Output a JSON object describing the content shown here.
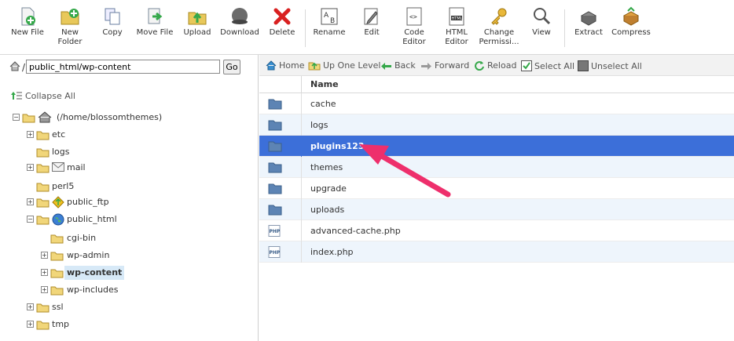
{
  "toolbar": {
    "buttons": [
      {
        "label": "New File",
        "icon": "new-file-icon"
      },
      {
        "label": "New Folder",
        "icon": "new-folder-icon"
      },
      {
        "label": "Copy",
        "icon": "copy-icon"
      },
      {
        "label": "Move File",
        "icon": "move-file-icon"
      },
      {
        "label": "Upload",
        "icon": "upload-icon"
      },
      {
        "label": "Download",
        "icon": "download-icon"
      },
      {
        "label": "Delete",
        "icon": "delete-icon"
      },
      {
        "label": "Rename",
        "icon": "rename-icon"
      },
      {
        "label": "Edit",
        "icon": "edit-icon"
      },
      {
        "label": "Code Editor",
        "icon": "code-editor-icon"
      },
      {
        "label": "HTML Editor",
        "icon": "html-editor-icon"
      },
      {
        "label": "Change Permissi...",
        "icon": "key-icon"
      },
      {
        "label": "View",
        "icon": "magnifier-icon"
      },
      {
        "label": "Extract",
        "icon": "extract-icon"
      },
      {
        "label": "Compress",
        "icon": "compress-icon"
      }
    ]
  },
  "left": {
    "path_value": "public_html/wp-content",
    "go_label": "Go",
    "collapse_label": "Collapse All",
    "tree": [
      {
        "label": "(/home/blossomthemes)"
      },
      {
        "label": "etc"
      },
      {
        "label": "logs"
      },
      {
        "label": "mail"
      },
      {
        "label": "perl5"
      },
      {
        "label": "public_ftp"
      },
      {
        "label": "public_html"
      },
      {
        "label": "cgi-bin"
      },
      {
        "label": "wp-admin"
      },
      {
        "label": "wp-content"
      },
      {
        "label": "wp-includes"
      },
      {
        "label": "ssl"
      },
      {
        "label": "tmp"
      }
    ]
  },
  "nav": {
    "home": "Home",
    "up": "Up One Level",
    "back": "Back",
    "forward": "Forward",
    "reload": "Reload",
    "select_all": "Select All",
    "unselect_all": "Unselect All"
  },
  "grid": {
    "header_name": "Name",
    "rows": [
      {
        "name": "cache",
        "type": "folder"
      },
      {
        "name": "logs",
        "type": "folder"
      },
      {
        "name": "plugins123",
        "type": "folder",
        "selected": true
      },
      {
        "name": "themes",
        "type": "folder"
      },
      {
        "name": "upgrade",
        "type": "folder"
      },
      {
        "name": "uploads",
        "type": "folder"
      },
      {
        "name": "advanced-cache.php",
        "type": "php"
      },
      {
        "name": "index.php",
        "type": "php"
      }
    ]
  },
  "colors": {
    "selected_row": "#3c6fd9",
    "alt_row": "#eef5fc",
    "arrow": "#ee2f6c",
    "tree_selected": "#d7e9f7"
  }
}
